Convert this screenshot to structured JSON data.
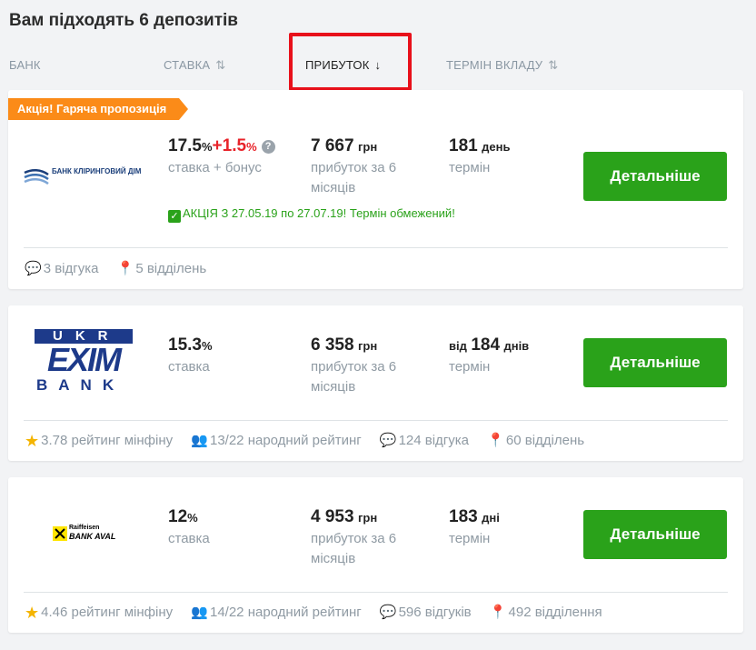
{
  "title": "Вам підходять 6 депозитів",
  "columns": {
    "bank": "БАНК",
    "rate": "СТАВКА",
    "profit": "ПРИБУТОК",
    "term": "ТЕРМІН ВКЛАДУ"
  },
  "sort_arrows": {
    "inactive": "⇅",
    "active": "↓"
  },
  "cards": [
    {
      "promo": "Акція! Гаряча пропозиція",
      "bank_logo_text": "БАНК КЛІРИНГОВИЙ ДІМ",
      "rate": "17.5",
      "rate_unit": "%",
      "bonus": "+1.5",
      "bonus_unit": "%",
      "rate_label": "ставка + бонус",
      "profit": "7 667",
      "profit_unit": "грн",
      "profit_label": "прибуток за 6 місяців",
      "term_prefix": "",
      "term": "181",
      "term_unit": "день",
      "term_label": "термін",
      "note": "АКЦІЯ З 27.05.19 по 27.07.19! Термін обмежений!",
      "button": "Детальніше",
      "footer": {
        "reviews": "3 відгука",
        "branches": "5 відділень"
      }
    },
    {
      "bank_logo_text": "UKR EXIM BANK",
      "logo_top": "UKR",
      "logo_mid": "EXIM",
      "logo_bot": "BANK",
      "rate": "15.3",
      "rate_unit": "%",
      "rate_label": "ставка",
      "profit": "6 358",
      "profit_unit": "грн",
      "profit_label": "прибуток за 6 місяців",
      "term_prefix": "від",
      "term": "184",
      "term_unit": "днів",
      "term_label": "термін",
      "button": "Детальніше",
      "footer": {
        "minfin_rating": "3.78 рейтинг мінфіну",
        "people_rating": "13/22 народний рейтинг",
        "reviews": "124 відгука",
        "branches": "60 відділень"
      }
    },
    {
      "bank_logo_text": "Raiffeisen BANK AVAL",
      "logo_top": "Raiffeisen",
      "logo_bot": "BANK AVAL",
      "rate": "12",
      "rate_unit": "%",
      "rate_label": "ставка",
      "profit": "4 953",
      "profit_unit": "грн",
      "profit_label": "прибуток за 6 місяців",
      "term_prefix": "",
      "term": "183",
      "term_unit": "дні",
      "term_label": "термін",
      "button": "Детальніше",
      "footer": {
        "minfin_rating": "4.46 рейтинг мінфіну",
        "people_rating": "14/22 народний рейтинг",
        "reviews": "596 відгуків",
        "branches": "492 відділення"
      }
    }
  ],
  "colors": {
    "accent_green": "#2aa21a",
    "promo_orange": "#fb8b18",
    "bonus_red": "#e8232a",
    "highlight_red": "#e8101a",
    "exim_blue": "#1d3a8a"
  }
}
